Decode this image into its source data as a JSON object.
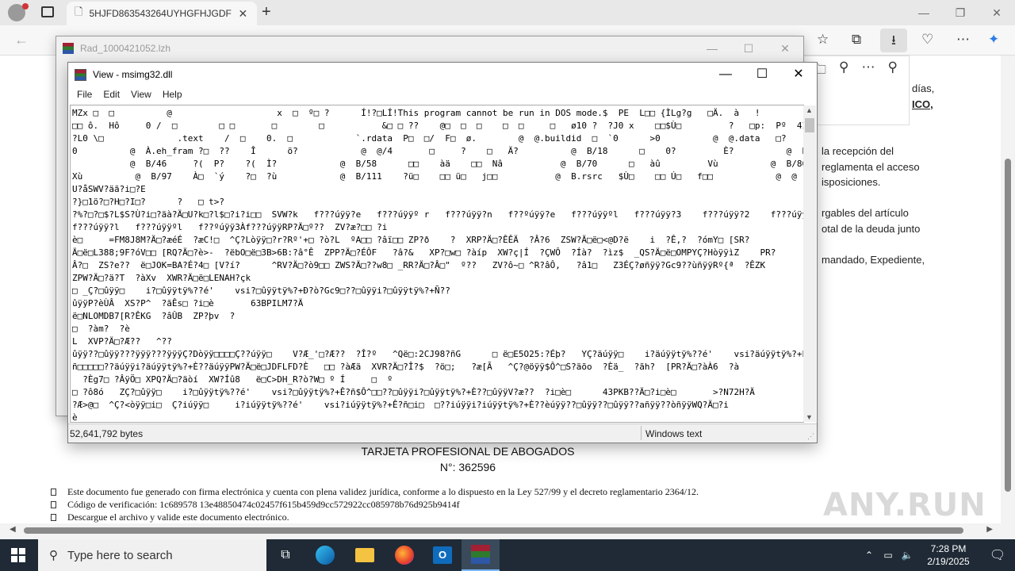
{
  "browser": {
    "tab_title": "5HJFD863543264UYHGFHJGDF86",
    "tab_close": "✕",
    "new_tab": "+",
    "window_controls": [
      "—",
      "❐",
      "✕"
    ]
  },
  "page": {
    "side_lines": [
      "días,",
      "ICO,",
      "la recepción del",
      "reglamenta el acceso",
      "isposiciones.",
      "rgables del artículo",
      "otal de la deuda junto",
      "mandado, Expediente,"
    ],
    "doc_title": "TARJETA PROFESIONAL DE ABOGADOS",
    "doc_number": "N°: 362596",
    "bullets": [
      "Este documento fue generado con firma electrónica y cuenta con plena validez jurídica, conforme a lo dispuesto en la Ley 527/99 y el decreto reglamentario 2364/12.",
      "Código de verificación: 1c689578 13e48850474c02457f615b459d9cc572922cc085978b76d925b9414f",
      "Descargue el archivo y valide este documento electrónico."
    ]
  },
  "rar_window": {
    "title": "Rad_1000421052.lzh",
    "controls": [
      "—",
      "☐",
      "✕"
    ]
  },
  "viewer": {
    "title": "View - msimg32.dll",
    "controls": [
      "—",
      "☐",
      "✕"
    ],
    "menu": [
      "File",
      "Edit",
      "View",
      "Help"
    ],
    "content": "MZx □  □          @                    x  □  º□ ?      Í!?□LÍ!This program cannot be run in DOS mode.$  PE  L□□ {ÌLg?g   □Ä.  à   !\n□□ ô.  Hô     0 /  □        □ □       □        □           &□ □ ??    @□  □  □    □  □     □   ø10 ?  ?J0 x    □□$Ù□         ?   □p:  Pº  4Î□   `0\n?L0 \\□              .text    /  □    0.  □            `.rdata  P□  □/  F□  ø.        @  @.buildid  □  `0      >0          @  @.data   □?    p0  ??   @\n0          @  À.eh_fram ?□  ??    Î      ö?            @  @/4       □     ?    □   Ä?          @  B/18      □    0?         È?          @  B/33      □    @?        Ê?\n           @  B/46     ?(  P?    ?(  Ì?            @  B/58      □□    àä    □□  Nâ           @  B/70      □   àû         Vù          @  B/86     `□   ü   Z□\nXù          @  B/97    À□  `ý    ?□  ?ù            @  B/111    ?ü□    □□ ü□   j□□           @  B.rsrc   $Ù□    □□ Ú□   f□□            @  @\nU?åSWV?äã?i□?E\n?}□1ö?□?H□?I□?      ?   □ t>?\n?%?□?□$?L$S?Ù?i□?äà?Ä□U?k□?l$□?i?i□□  SVW?k   f???úÿÿ?e   f???úÿÿº r   f???úÿÿ?n   f??ºúÿÿ?e   f???úÿÿºl   f???úÿÿ?3    f???úÿÿ?2    f???úÿÿº.   f???úÿÿ?d\nf???úÿÿ?l   f???úÿÿºl   f??ºúÿÿ3Àf???úÿÿRP?Ä□º??  ZV?æ?□□ ?i\nè□     =FM8J8M?Ä□?æéÉ  ?æC!□  ^Ç?Lòÿÿ□?r?Rº'+□ ?ò?L  ºA□□ ?âï□□ ZP?ð    ?  XRP?Ä□?ÊÊÄ  ?Â?6  ZSW?Ä□ë□<@D?ë    i  ?Ê,?  ?ómY□ [SR?\nÄ□ë□L388;9F?óV□□ [RQ?Ä□?è>-  ?ëbO□ë□3B>6B:?â°Ê  ZPP?Ä□?ÉÔF   ?â?&   XP?□w□ ?àíp  XW?ç|Í  ?ÇWÔ  ?Íà?  ?ìz$  _QS?Ä□ë□OMPYÇ?HòÿÿìZ    PR?\nÂ?□  ZS?e??  ë□JOK=BA?É?4□ [V?í?      ^RV?Ä□?ò9□□ ZWS?Ä□??w8□ _RR?Ä□?Â□\"  º??   ZV?ô~□ ^R?âÔ,   ?â1□   Z3ÉÇ?øñÿÿ?Gc9??ùñÿÿRº{ª  ?ÊZK\nZPW?Ä□?ä?T  ?àXv  XWR?Ä□ë□LENAH?çk\n□ _Ç?□ûÿÿ□    i?□ûÿÿtÿ%??é'    vsi?□ûÿÿtÿ%?+Ð?ò?Gc9□??□ûÿÿi?□ûÿÿtÿ%?+Ñ??\nûÿÿP?èÙÂ  XS?P^  ?ãÊs□ ?i□è       63BPILM7?Ä\në□NLOMDB7[R?ÊKG  ?âÛB  ZP?þv  ?\n□  ?àm?  ?è\nL  XVP?Ä□?Æ??   ^??\nûÿÿ??□ûÿÿ???ÿÿÿ???ÿÿÿÇ?Dòÿÿ□□□□Ç??úÿÿ□    V?Æ_'□?Æ??  ?Î?º   ^Që□:2CJ98?ñG      □ ë□E5O25:?Éþ?   YÇ?äúÿÿ□    i?äúÿÿtÿ%??é'    vsi?äúÿÿtÿ%?+Ê?\nñ□□□□□??äúÿÿi?äúÿÿtÿ%?+È??äúÿÿPW?Ä□ë□JDFLFD?È   □□ ?àÆä  XVR?Ä□?Î?$  ?ö□;   ?æ[Ã   ^Ç?@öÿÿ$Ô^□S?äõo  ?Èä_  ?ãh?  [PR?Ä□?àÀ6  ?à\n  ?Èg7□ ?ÂÿÖ□ XPQ?Ä□?äòí  XW?Íû8   ë□C>DH_R?ò?W□ º Í     □  º\n□ ?ô8ó   ZÇ?□ûÿÿ□    i?□ûÿÿtÿ%??é'    vsi?□ûÿÿtÿ%?+Ê?ñ$Ô^□□??□ûÿÿi?□ûÿÿtÿ%?+È??□ûÿÿV?æ??  ?i□è□      43PKB??Ä□?i□è□       >?N72H?Ä\n?Æ>@□  ^Ç?<òÿÿ□i□  Ç?iúÿÿ□     i?iúÿÿtÿ%??é'    vsi?iúÿÿtÿ%?+Ê?ñ□i□  □??iúÿÿi?iúÿÿtÿ%?+È??èúÿÿ??□ûÿÿ??□ûÿÿ??añÿÿ??òñÿÿWQ?Ä□?i\nè",
    "status_size": "52,641,792 bytes",
    "status_encoding": "Windows text"
  },
  "watermark": "ANY.RUN",
  "taskbar": {
    "search_placeholder": "Type here to search",
    "time": "7:28 PM",
    "date": "2/19/2025"
  }
}
